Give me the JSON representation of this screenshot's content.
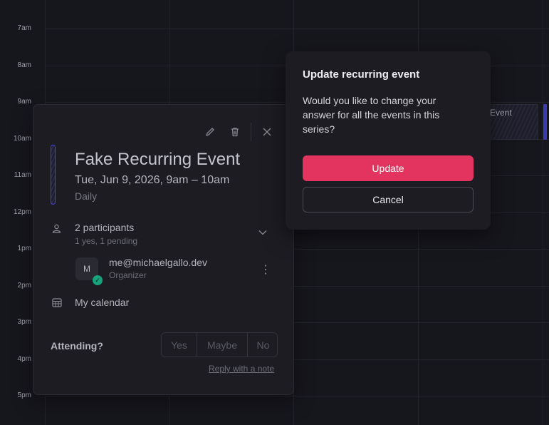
{
  "calendar": {
    "times": [
      "7am",
      "8am",
      "9am",
      "10am",
      "11am",
      "12pm",
      "1pm",
      "2pm",
      "3pm",
      "4pm",
      "5pm"
    ],
    "bg_event_label": "Event"
  },
  "popover": {
    "title": "Fake Recurring Event",
    "datetime": "Tue, Jun 9, 2026, 9am  –  10am",
    "recurrence": "Daily",
    "participants_label": "2 participants",
    "participants_status": "1 yes, 1 pending",
    "participant": {
      "initial": "M",
      "email": "me@michaelgallo.dev",
      "role": "Organizer"
    },
    "calendar_name": "My calendar",
    "attending_label": "Attending?",
    "rsvp": [
      "Yes",
      "Maybe",
      "No"
    ],
    "reply_note": "Reply with a note",
    "icons": [
      "pencil-icon",
      "trash-icon",
      "close-icon",
      "person-icon",
      "chevron-down-icon",
      "kebab-icon",
      "calendar-icon",
      "check-icon"
    ]
  },
  "dialog": {
    "title": "Update recurring event",
    "message": "Would you like to change your answer for all the events in this series?",
    "update_label": "Update",
    "cancel_label": "Cancel"
  },
  "colors": {
    "accent": "#e3335f",
    "event": "#3b3bb3",
    "success": "#16a37e"
  }
}
